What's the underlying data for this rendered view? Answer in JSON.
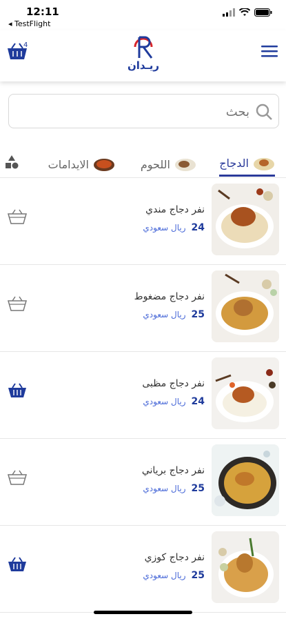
{
  "status": {
    "time": "12:11",
    "back_app": "◂ TestFlight"
  },
  "header": {
    "cart_count": "4",
    "logo_text": "ريـدان",
    "colors": {
      "brand_blue": "#1f3b9c",
      "brand_red": "#d8262b"
    }
  },
  "search": {
    "placeholder": "بحث"
  },
  "tabs": [
    {
      "label": "الدجاج",
      "active": true
    },
    {
      "label": "اللحوم",
      "active": false
    },
    {
      "label": "الايدامات",
      "active": false
    }
  ],
  "products": [
    {
      "name": "نفر دجاج مندي",
      "price": "24",
      "currency": "ريال سعودي",
      "in_cart": false
    },
    {
      "name": "نفر دجاج مضغوط",
      "price": "25",
      "currency": "ريال سعودي",
      "in_cart": false
    },
    {
      "name": "نفر دجاج مظبى",
      "price": "24",
      "currency": "ريال سعودي",
      "in_cart": true
    },
    {
      "name": "نفر دجاج برياني",
      "price": "25",
      "currency": "ريال سعودي",
      "in_cart": false
    },
    {
      "name": "نفر دجاج كوزي",
      "price": "25",
      "currency": "ريال سعودي",
      "in_cart": true
    }
  ]
}
